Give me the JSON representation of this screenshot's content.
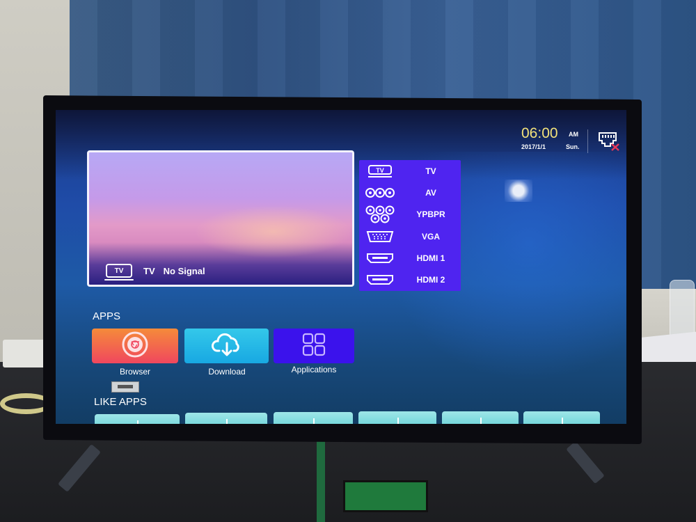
{
  "clock": {
    "time": "06:00",
    "ampm": "AM",
    "date": "2017/1/1",
    "day": "Sun."
  },
  "network": {
    "icon": "ethernet-disconnected-icon",
    "status": "disconnected"
  },
  "preview": {
    "source_icon": "tv-icon",
    "source": "TV",
    "status": "No Signal"
  },
  "sources": [
    {
      "label": "TV",
      "icon": "tv-icon"
    },
    {
      "label": "AV",
      "icon": "av-rca-icon"
    },
    {
      "label": "YPBPR",
      "icon": "ypbpr-component-icon"
    },
    {
      "label": "VGA",
      "icon": "vga-port-icon"
    },
    {
      "label": "HDMI 1",
      "icon": "hdmi-port-icon"
    },
    {
      "label": "HDMI 2",
      "icon": "hdmi-port-icon"
    }
  ],
  "apps": {
    "title": "APPS",
    "items": [
      {
        "label": "Browser",
        "icon": "browser-icon",
        "color": "#f0475e"
      },
      {
        "label": "Download",
        "icon": "cloud-download-icon",
        "color": "#18a8e2"
      },
      {
        "label": "Applications",
        "icon": "grid-icon",
        "color": "#3b12ec"
      }
    ]
  },
  "like_apps": {
    "title": "LIKE APPS",
    "count": 6
  },
  "colors": {
    "source_panel": "#4f24f0",
    "clock_time": "#f3e27a",
    "network_error": "#e8385a"
  }
}
